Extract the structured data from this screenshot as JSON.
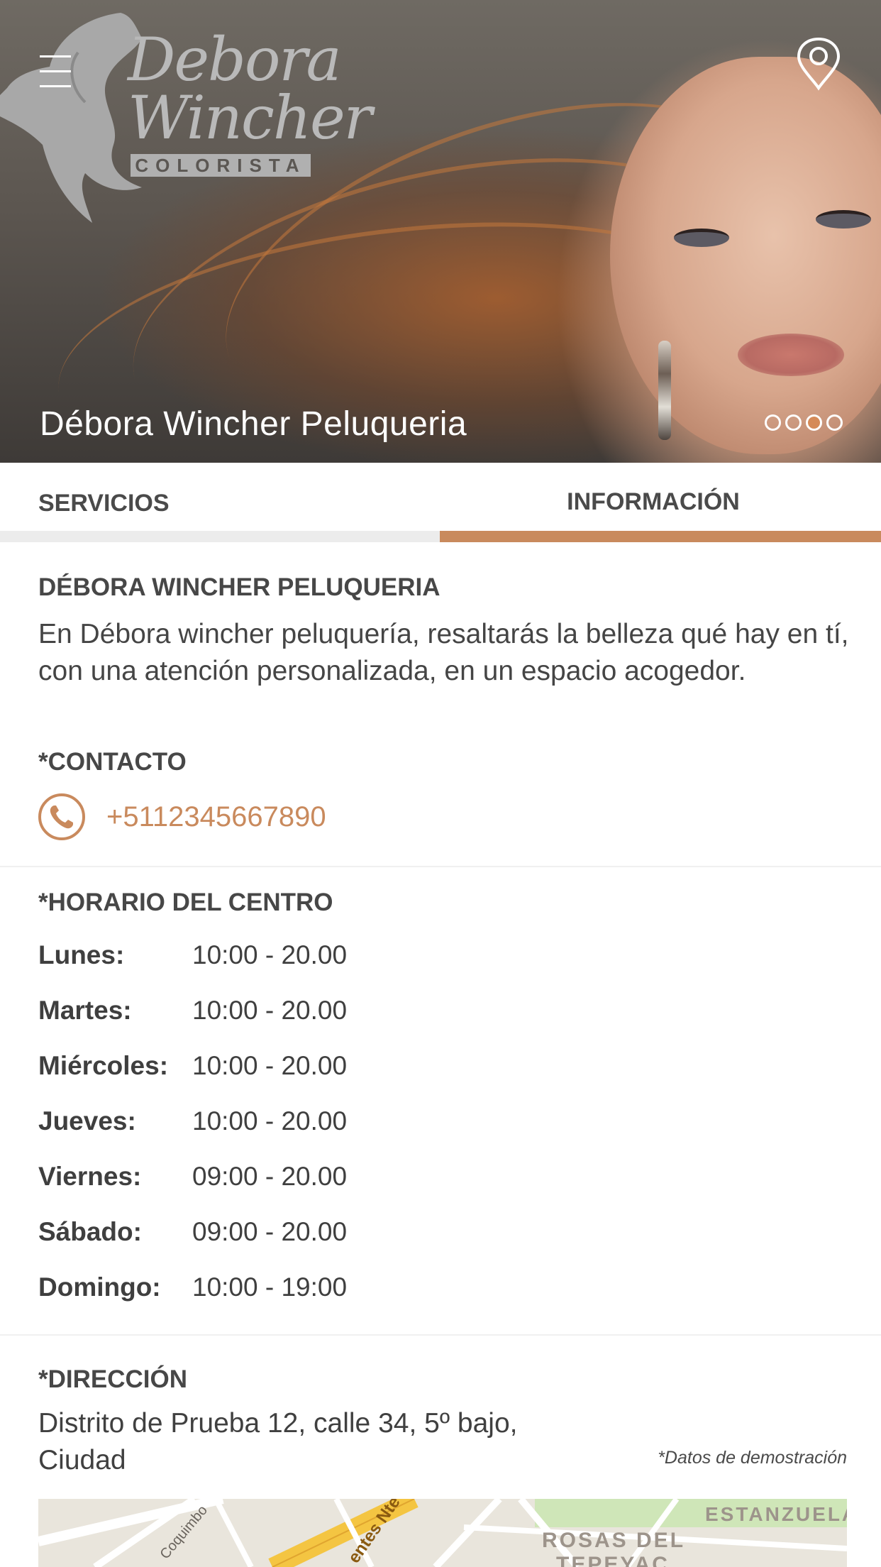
{
  "hero": {
    "title": "Débora Wincher Peluqueria",
    "logo": {
      "line1": "Debora",
      "line2": "Wincher",
      "subtitle": "COLORISTA"
    },
    "carousel": {
      "count": 4,
      "active_index": 2
    }
  },
  "tabs": [
    {
      "label": "SERVICIOS",
      "active": false
    },
    {
      "label": "INFORMACIÓN",
      "active": true
    }
  ],
  "about": {
    "title": "DÉBORA WINCHER PELUQUERIA",
    "text": "En Débora wincher peluquería, resaltarás la belleza qué hay en tí, con una atención personalizada, en un espacio acogedor."
  },
  "contact": {
    "title": "*CONTACTO",
    "phone": "+5112345667890",
    "icon": "phone-icon"
  },
  "schedule": {
    "title": "*HORARIO DEL CENTRO",
    "rows": [
      {
        "day": "Lunes:",
        "hours": "10:00 - 20.00"
      },
      {
        "day": "Martes:",
        "hours": "10:00 - 20.00"
      },
      {
        "day": "Miércoles:",
        "hours": "10:00 - 20.00"
      },
      {
        "day": "Jueves:",
        "hours": "10:00 - 20.00"
      },
      {
        "day": "Viernes:",
        "hours": "09:00 - 20.00"
      },
      {
        "day": "Sábado:",
        "hours": "09:00 - 20.00"
      },
      {
        "day": "Domingo:",
        "hours": "10:00 - 19:00"
      }
    ]
  },
  "address": {
    "title": "*DIRECCIÓN",
    "text": "Distrito de Prueba 12, calle 34, 5º bajo, Ciudad",
    "note": "*Datos de demostración"
  },
  "map": {
    "labels": [
      "ESTANZUELA",
      "ROSAS DEL",
      "TEPEYAC",
      "Coquimbo",
      "entes Nte"
    ]
  },
  "colors": {
    "accent": "#c98a5d",
    "text": "#3d3d3d",
    "tab_inactive_bar": "#ececec"
  }
}
